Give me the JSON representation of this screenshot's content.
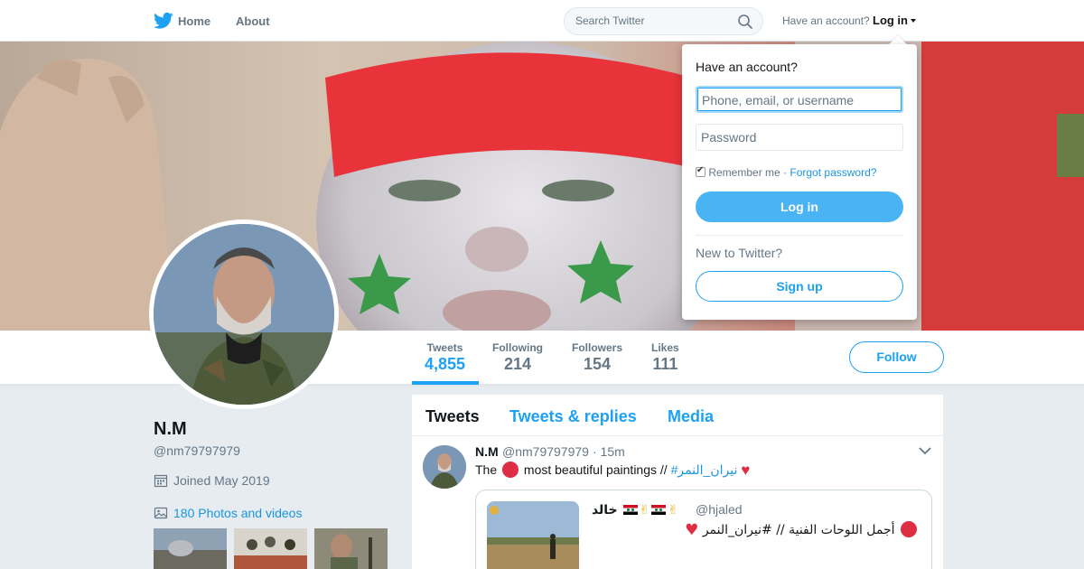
{
  "nav": {
    "home_label": "Home",
    "about_label": "About",
    "search_placeholder": "Search Twitter",
    "have_account": "Have an account?",
    "login_label": "Log in"
  },
  "profile": {
    "name": "N.M",
    "handle": "@nm79797979",
    "joined": "Joined May 2019",
    "photos_label": "180 Photos and videos",
    "follow_label": "Follow",
    "stats": [
      {
        "label": "Tweets",
        "value": "4,855"
      },
      {
        "label": "Following",
        "value": "214"
      },
      {
        "label": "Followers",
        "value": "154"
      },
      {
        "label": "Likes",
        "value": "111"
      }
    ]
  },
  "timeline": {
    "tabs": [
      "Tweets",
      "Tweets & replies",
      "Media"
    ],
    "tweet": {
      "name": "N.M",
      "handle": "@nm79797979",
      "time": "· 15m",
      "text_before": "The",
      "text_middle": "most beautiful paintings //",
      "hashtag": "#نيران_النمر",
      "quote": {
        "author": "خالد",
        "handle": "@hjaled",
        "text": "أجمل اللوحات الفنية // #نيران_النمر"
      }
    }
  },
  "login_dropdown": {
    "title": "Have an account?",
    "username_placeholder": "Phone, email, or username",
    "password_placeholder": "Password",
    "remember_label": "Remember me ·",
    "forgot_label": "Forgot password?",
    "login_button": "Log in",
    "new_label": "New to Twitter?",
    "signup_button": "Sign up"
  },
  "colors": {
    "accent": "#1da1f2",
    "login_button": "#4ab3f4",
    "background": "#e6ecf0"
  }
}
